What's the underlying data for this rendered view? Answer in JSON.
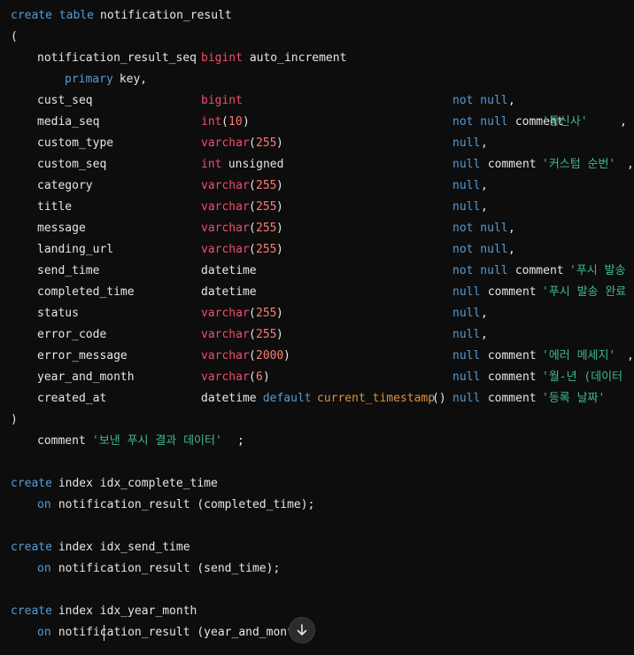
{
  "code": {
    "l0": {
      "create": "create table ",
      "name": "notification_result"
    },
    "l1": {
      "paren": "("
    },
    "l2": {
      "col": "notification_result_seq ",
      "type": "bigint",
      "rest": " auto_increment"
    },
    "l3": {
      "kw": "primary",
      "rest": " key,"
    },
    "l4": {
      "col": "cust_seq",
      "type": "bigint",
      "c1": "not null",
      "c2": ","
    },
    "l5": {
      "col": "media_seq",
      "type": "int",
      "p1": "(",
      "n": "10",
      "p2": ")",
      "c1": "not null",
      "c2": " comment ",
      "s": "'통신사'",
      "c3": ","
    },
    "l6": {
      "col": "custom_type",
      "type": "varchar",
      "p1": "(",
      "n": "255",
      "p2": ")",
      "c1": "null",
      "c2": ","
    },
    "l7": {
      "col": "custom_seq",
      "type": "int",
      "t2": " unsigned",
      "c1": "null",
      "c2": " comment ",
      "s": "'커스텀 순번'",
      "c3": ","
    },
    "l8": {
      "col": "category",
      "type": "varchar",
      "p1": "(",
      "n": "255",
      "p2": ")",
      "c1": "null",
      "c2": ","
    },
    "l9": {
      "col": "title",
      "type": "varchar",
      "p1": "(",
      "n": "255",
      "p2": ")",
      "c1": "null",
      "c2": ","
    },
    "l10": {
      "col": "message",
      "type": "varchar",
      "p1": "(",
      "n": "255",
      "p2": ")",
      "c1": "not null",
      "c2": ","
    },
    "l11": {
      "col": "landing_url",
      "type": "varchar",
      "p1": "(",
      "n": "255",
      "p2": ")",
      "c1": "not null",
      "c2": ","
    },
    "l12": {
      "col": "send_time",
      "type": "datetime",
      "c1": "not null",
      "c2": " comment ",
      "s": "'푸시 발송"
    },
    "l13": {
      "col": "completed_time",
      "type": "datetime",
      "c1": "null",
      "c2": " comment ",
      "s": "'푸시 발송 완료"
    },
    "l14": {
      "col": "status",
      "type": "varchar",
      "p1": "(",
      "n": "255",
      "p2": ")",
      "c1": "null",
      "c2": ","
    },
    "l15": {
      "col": "error_code",
      "type": "varchar",
      "p1": "(",
      "n": "255",
      "p2": ")",
      "c1": "null",
      "c2": ","
    },
    "l16": {
      "col": "error_message",
      "type": "varchar",
      "p1": "(",
      "n": "2000",
      "p2": ")",
      "c1": "null",
      "c2": " comment ",
      "s": "'에러 메세지'",
      "c3": ","
    },
    "l17": {
      "col": "year_and_month",
      "type": "varchar",
      "p1": "(",
      "n": "6",
      "p2": ")",
      "c1": "null",
      "c2": " comment ",
      "s": "'월-년 (데이터"
    },
    "l18": {
      "col": "created_at",
      "type": "datetime",
      "kw": " default ",
      "fn": "current_timestamp",
      "fp": "()",
      "c1": "null",
      "c2": " comment ",
      "s": "'등록 날짜'"
    },
    "l19": {
      "paren": ")"
    },
    "l20": {
      "kw": "comment ",
      "s": "'보낸 푸시 결과 데이터'",
      "end": ";"
    },
    "l22": {
      "create": "create",
      "rest": " index idx_complete_time"
    },
    "l23": {
      "on": "on",
      "rest": " notification_result (completed_time);"
    },
    "l25": {
      "create": "create",
      "rest": " index idx_send_time"
    },
    "l26": {
      "on": "on",
      "rest": " notification_result (send_time);"
    },
    "l28": {
      "create": "create",
      "rest": " index idx_year_month"
    },
    "l29": {
      "on": "on",
      "rest": " notification_result (year_and_mont"
    }
  },
  "scroll_button": {
    "icon": "arrow-down-icon"
  },
  "colors": {
    "background": "#0d0d0d",
    "keyword": "#569cd6",
    "type": "#f14c6c",
    "string": "#3fb98d",
    "function": "#e0913a",
    "identifier": "#e6e6e6"
  }
}
